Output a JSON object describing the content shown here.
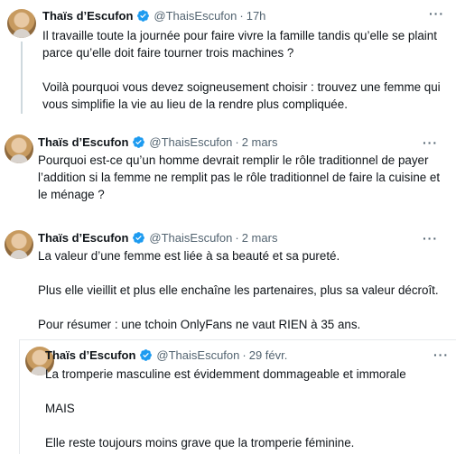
{
  "author": {
    "name": "Thaïs d’Escufon",
    "handle": "@ThaisEscufon"
  },
  "tweets": [
    {
      "date": "17h",
      "paragraphs": [
        "Il travaille toute la journée pour faire vivre la famille tandis qu’elle se plaint",
        "parce qu’elle doit faire tourner trois machines ?",
        "",
        "Voilà pourquoi vous devez soigneusement choisir : trouvez une femme qui",
        "vous simplifie la vie au lieu de la rendre plus compliquée."
      ]
    },
    {
      "date": "2 mars",
      "paragraphs": [
        "Pourquoi est-ce qu’un homme devrait remplir le rôle traditionnel de payer",
        "l’addition si la femme ne remplit pas le rôle traditionnel de faire la cuisine et",
        "le ménage ?"
      ]
    },
    {
      "date": "2 mars",
      "paragraphs": [
        "La valeur d’une femme est liée à sa beauté et sa pureté.",
        "",
        "Plus elle vieillit et plus elle enchaîne les partenaires, plus sa valeur décroît.",
        "",
        "Pour résumer : une tchoin OnlyFans ne vaut RIEN à 35 ans."
      ]
    },
    {
      "date": "29 févr.",
      "paragraphs": [
        "La tromperie masculine est évidemment dommageable et immorale",
        "",
        "MAIS",
        "",
        "Elle reste toujours moins grave que la tromperie féminine."
      ]
    }
  ],
  "separator": "·",
  "more_icon": "more-horizontal-icon",
  "colors": {
    "verified": "#1d9bf0",
    "secondary_text": "#536471",
    "text": "#0f1419"
  }
}
